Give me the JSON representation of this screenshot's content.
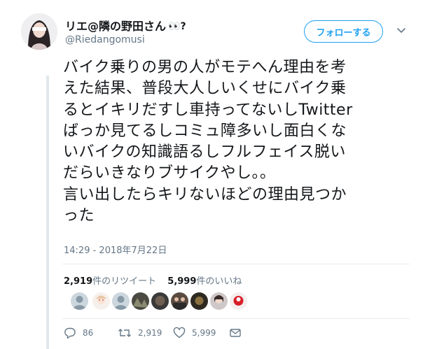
{
  "author": {
    "display_name": "リエ@隣の野田さん",
    "display_emoji": "👀?",
    "handle": "@Riedangomusi",
    "avatar_label": "avatar"
  },
  "follow_button_label": "フォローする",
  "tweet_lines": [
    "バイク乗りの男の人がモテへん理由を考",
    "えた結果、普段大人しいくせにバイク乗",
    "るとイキリだすし車持ってないしTwitter",
    "ばっか見てるしコミュ障多いし面白くな",
    "いバイクの知識語るしフルフェイス脱い",
    "だらいきなりブサイクやし。。",
    "言い出したらキリないほどの理由見つか",
    "った"
  ],
  "timestamp": "14:29 - 2018年7月22日",
  "stats": {
    "retweets_num": "2,919",
    "retweets_label": "件のリツイート",
    "likes_num": "5,999",
    "likes_label": "件のいいね"
  },
  "liker_avatars": [
    "default-avatar",
    "anime-avatar",
    "default-avatar",
    "dark-photo-avatar",
    "dark-photo-avatar",
    "people-photo-avatar",
    "dark-photo-avatar",
    "portrait-avatar",
    "red-character-avatar"
  ],
  "actions": {
    "reply_count": "86",
    "retweet_count": "2,919",
    "like_count": "5,999"
  },
  "colors": {
    "accent": "#1da1f2",
    "secondary_text": "#657786",
    "primary_text": "#14171a"
  }
}
